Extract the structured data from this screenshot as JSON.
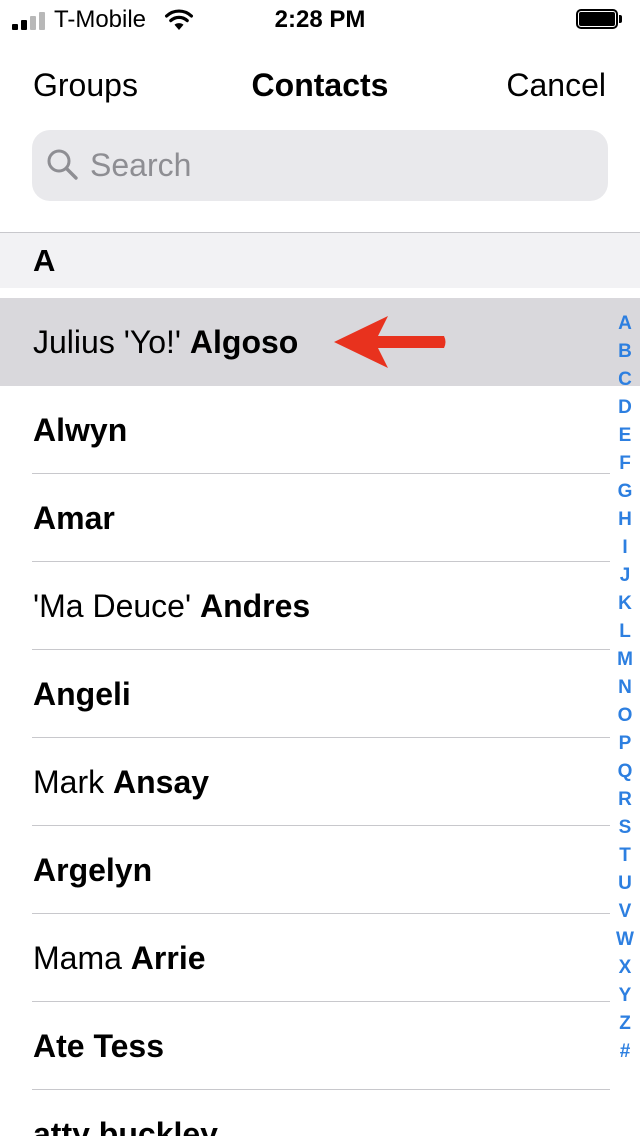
{
  "status_bar": {
    "carrier": "T-Mobile",
    "time": "2:28 PM",
    "signal_bars": 4,
    "signal_bars_filled": 2,
    "icons": [
      "signal-icon",
      "wifi-icon",
      "battery-icon"
    ]
  },
  "nav": {
    "left_label": "Groups",
    "title": "Contacts",
    "right_label": "Cancel"
  },
  "search": {
    "placeholder": "Search",
    "value": "",
    "icon": "search-icon"
  },
  "section": {
    "letter": "A"
  },
  "contacts": [
    {
      "first": "Julius 'Yo!'",
      "last": "Algoso",
      "highlighted": true
    },
    {
      "first": "",
      "last": "Alwyn",
      "highlighted": false
    },
    {
      "first": "",
      "last": "Amar",
      "highlighted": false
    },
    {
      "first": "'Ma Deuce'",
      "last": "Andres",
      "highlighted": false
    },
    {
      "first": "",
      "last": "Angeli",
      "highlighted": false
    },
    {
      "first": "Mark",
      "last": "Ansay",
      "highlighted": false
    },
    {
      "first": "",
      "last": "Argelyn",
      "highlighted": false
    },
    {
      "first": "Mama",
      "last": "Arrie",
      "highlighted": false
    },
    {
      "first": "",
      "last": "Ate Tess",
      "highlighted": false
    },
    {
      "first": "",
      "last": "atty buckley",
      "highlighted": false
    }
  ],
  "index_letters": [
    "A",
    "B",
    "C",
    "D",
    "E",
    "F",
    "G",
    "H",
    "I",
    "J",
    "K",
    "L",
    "M",
    "N",
    "O",
    "P",
    "Q",
    "R",
    "S",
    "T",
    "U",
    "V",
    "W",
    "X",
    "Y",
    "Z",
    "#"
  ],
  "annotation": {
    "icon": "red-arrow-left-icon",
    "color": "#e8321e"
  },
  "colors": {
    "accent": "#2d7fe0",
    "highlight_row": "#d9d8dc",
    "section_header_bg": "#f2f2f4",
    "search_bg": "#e9e9ec",
    "placeholder": "#8e8e93"
  }
}
